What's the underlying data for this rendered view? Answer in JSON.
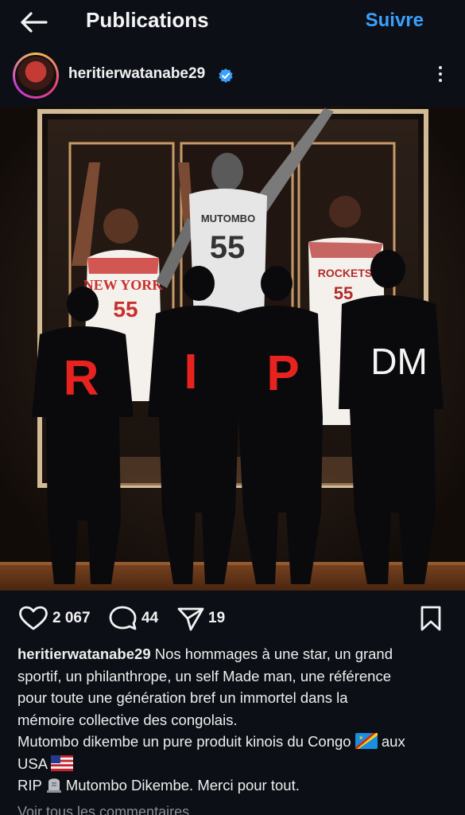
{
  "header": {
    "title": "Publications",
    "follow_label": "Suivre"
  },
  "post": {
    "username": "heritierwatanabe29",
    "image": {
      "jersey_left_team": "NEW YORK",
      "jersey_left_number": "55",
      "jersey_center_name": "MUTOMBO",
      "jersey_center_number": "55",
      "jersey_right_team": "ROCKETS",
      "jersey_right_number": "55",
      "silhouette_letters": [
        "R",
        "I",
        "P",
        "DM"
      ]
    },
    "likes": "2 067",
    "comments": "44",
    "shares": "19",
    "caption": {
      "line1": "Nos hommages à une star, un grand",
      "line2": "sportif, un philanthrope, un self Made man, une référence",
      "line3": "pour toute une génération bref un immortel dans la",
      "line4": "mémoire collective des congolais.",
      "line5": "Mutombo dikembe un pure produit kinois du Congo",
      "line5_tail": "aux",
      "line6": "USA",
      "line7a": "RIP",
      "line7b": "Mutombo Dikembe. Merci pour tout."
    },
    "view_all_comments": "Voir tous les commentaires"
  },
  "colors": {
    "background": "#0c1016",
    "accent": "#3aa0ff",
    "verified": "#3aa0ff",
    "rip_red": "#e8231f"
  }
}
